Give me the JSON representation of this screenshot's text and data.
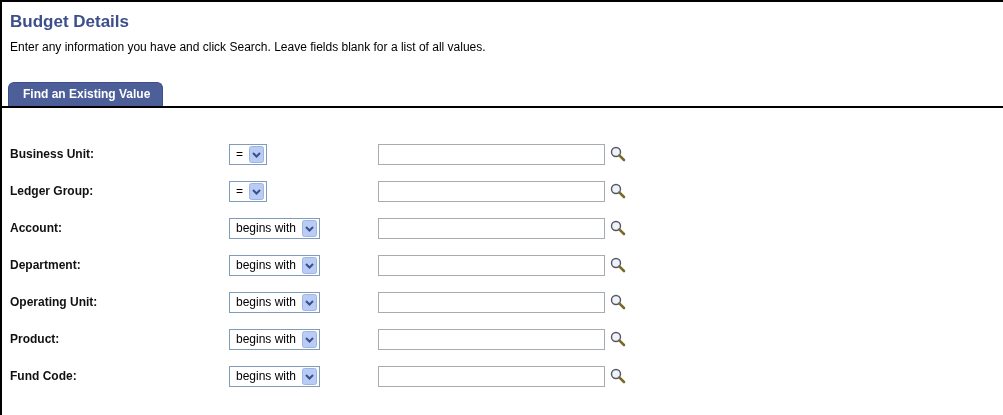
{
  "page": {
    "title": "Budget Details",
    "instructions": "Enter any information you have and click Search. Leave fields blank for a list of all values."
  },
  "tabs": [
    {
      "label": "Find an Existing Value",
      "selected": true
    }
  ],
  "fields": [
    {
      "label": "Business Unit:",
      "operator": "="
    },
    {
      "label": "Ledger Group:",
      "operator": "="
    },
    {
      "label": "Account:",
      "operator": "begins with"
    },
    {
      "label": "Department:",
      "operator": "begins with"
    },
    {
      "label": "Operating Unit:",
      "operator": "begins with"
    },
    {
      "label": "Product:",
      "operator": "begins with"
    },
    {
      "label": "Fund Code:",
      "operator": "begins with"
    }
  ]
}
